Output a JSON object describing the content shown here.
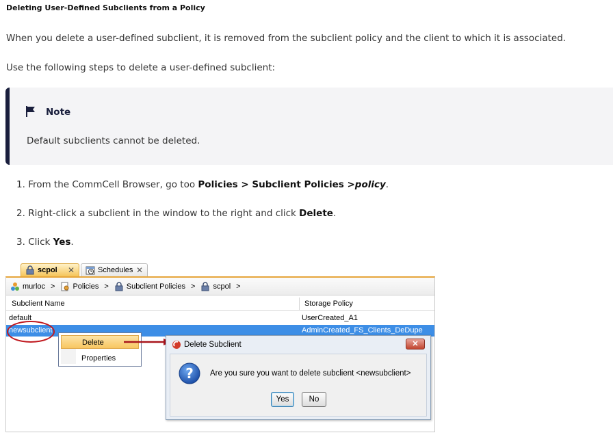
{
  "doc": {
    "title": "Deleting User-Defined Subclients from a Policy",
    "intro": "When you delete a user-defined subclient, it is removed from the subclient policy and the client to which it is associated.",
    "steps_intro": "Use the following steps to delete a user-defined subclient:",
    "note": {
      "title": "Note",
      "body": "Default subclients cannot be deleted."
    },
    "steps": [
      {
        "num": "1.",
        "text": "From the CommCell Browser, go too ",
        "bold": "Policies > Subclient Policies >",
        "italic": "policy",
        "end": "."
      },
      {
        "num": "2.",
        "text": "Right-click a subclient in the window to the right and click ",
        "bold": "Delete",
        "end": "."
      },
      {
        "num": "3.",
        "text": "Click ",
        "bold": "Yes",
        "end": "."
      }
    ]
  },
  "app": {
    "tabs": [
      {
        "label": "scpol",
        "close": "✕",
        "icon": "lock-icon"
      },
      {
        "label": "Schedules",
        "close": "✕",
        "icon": "calendar-clock-icon"
      }
    ],
    "breadcrumb": [
      {
        "label": "murloc",
        "icon": "commcell-icon"
      },
      {
        "label": "Policies",
        "icon": "policies-icon"
      },
      {
        "label": "Subclient Policies",
        "icon": "subclient-policies-icon"
      },
      {
        "label": "scpol",
        "icon": "lock-icon"
      }
    ],
    "breadcrumb_sep": ">",
    "columns": [
      "Subclient Name",
      "Storage Policy"
    ],
    "rows": [
      {
        "name": "default",
        "policy": "UserCreated_A1"
      },
      {
        "name": "newsubclient",
        "policy": "AdminCreated_FS_Clients_DeDupe"
      }
    ],
    "context_menu": [
      "Delete",
      "Properties"
    ],
    "dialog": {
      "title": "Delete Subclient",
      "close": "✕",
      "message": "Are you sure you want to delete subclient <newsubclient>",
      "yes": "Yes",
      "no": "No"
    },
    "colors": {
      "selection": "#3d8ee6",
      "highlight_circle": "#c0191f",
      "tab_accent": "#e6a53a"
    }
  }
}
